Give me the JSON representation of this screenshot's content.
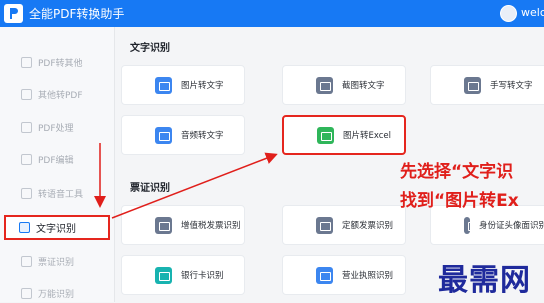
{
  "header": {
    "app_title": "全能PDF转换助手",
    "user": "welc"
  },
  "sidebar": {
    "items": [
      {
        "label": "PDF转其他"
      },
      {
        "label": "其他转PDF"
      },
      {
        "label": "PDF处理"
      },
      {
        "label": "PDF编辑"
      },
      {
        "label": "转语音工具"
      },
      {
        "label": "文字识别",
        "active": true
      },
      {
        "label": "票证识别"
      },
      {
        "label": "万能识别"
      }
    ]
  },
  "sections": [
    {
      "title": "文字识别",
      "cards": [
        {
          "label": "图片转文字",
          "icon": "image-text-icon"
        },
        {
          "label": "截图转文字",
          "icon": "screenshot-text-icon"
        },
        {
          "label": "手写转文字",
          "icon": "handwriting-text-icon"
        },
        {
          "label": "音频转文字",
          "icon": "audio-text-icon"
        },
        {
          "label": "图片转Excel",
          "icon": "image-excel-icon",
          "highlighted": true
        }
      ]
    },
    {
      "title": "票证识别",
      "cards": [
        {
          "label": "增值税发票识别",
          "icon": "vat-invoice-icon"
        },
        {
          "label": "定额发票识别",
          "icon": "quota-invoice-icon"
        },
        {
          "label": "身份证头像面识别",
          "icon": "id-card-icon"
        },
        {
          "label": "银行卡识别",
          "icon": "bank-card-icon"
        },
        {
          "label": "营业执照识别",
          "icon": "business-license-icon"
        }
      ]
    }
  ],
  "annotation": {
    "line1": "先选择“文字识",
    "line2": "找到“图片转Ex"
  },
  "watermark": "最需网",
  "colors": {
    "brand": "#1779f4",
    "annotation": "#e01f1b"
  }
}
